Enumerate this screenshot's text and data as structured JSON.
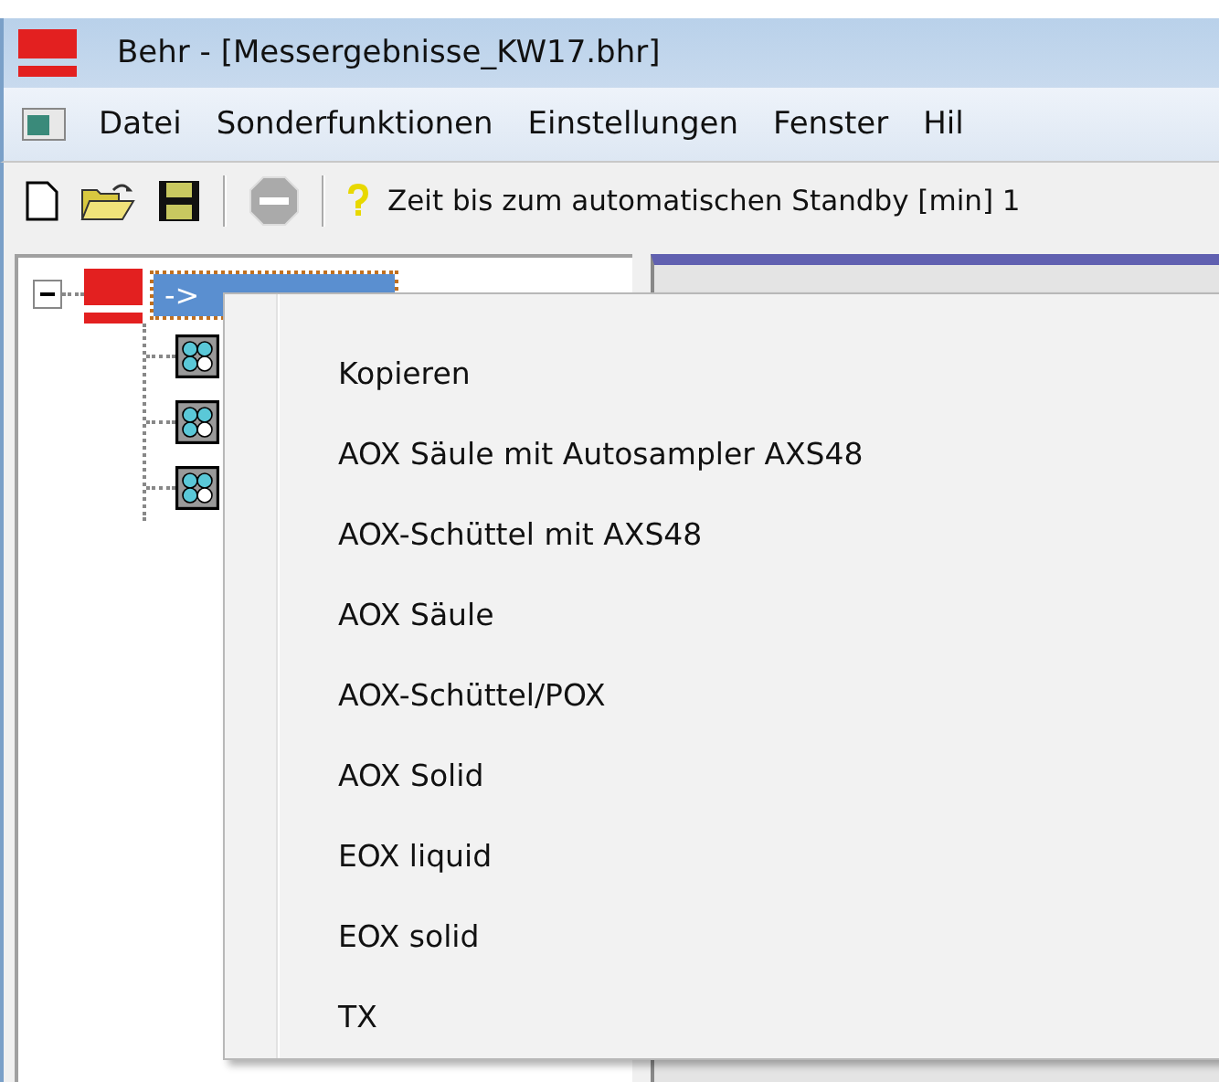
{
  "window": {
    "title": "Behr - [Messergebnisse_KW17.bhr]"
  },
  "menu_bar": [
    "Datei",
    "Sonderfunktionen",
    "Einstellungen",
    "Fenster",
    "Hil"
  ],
  "toolbar": {
    "help_text": "Zeit bis zum automatischen Standby [min] 1"
  },
  "tree": {
    "root": {
      "label": "->",
      "selected": true,
      "expanded": true,
      "children": [
        {
          "kind": "module"
        },
        {
          "kind": "module"
        },
        {
          "kind": "module"
        }
      ]
    }
  },
  "context_menu": [
    "Kopieren",
    "AOX Säule mit Autosampler AXS48",
    "AOX-Schüttel mit AXS48",
    "AOX Säule",
    "AOX-Schüttel/POX",
    "AOX Solid",
    "EOX liquid",
    "EOX solid",
    "TX"
  ]
}
